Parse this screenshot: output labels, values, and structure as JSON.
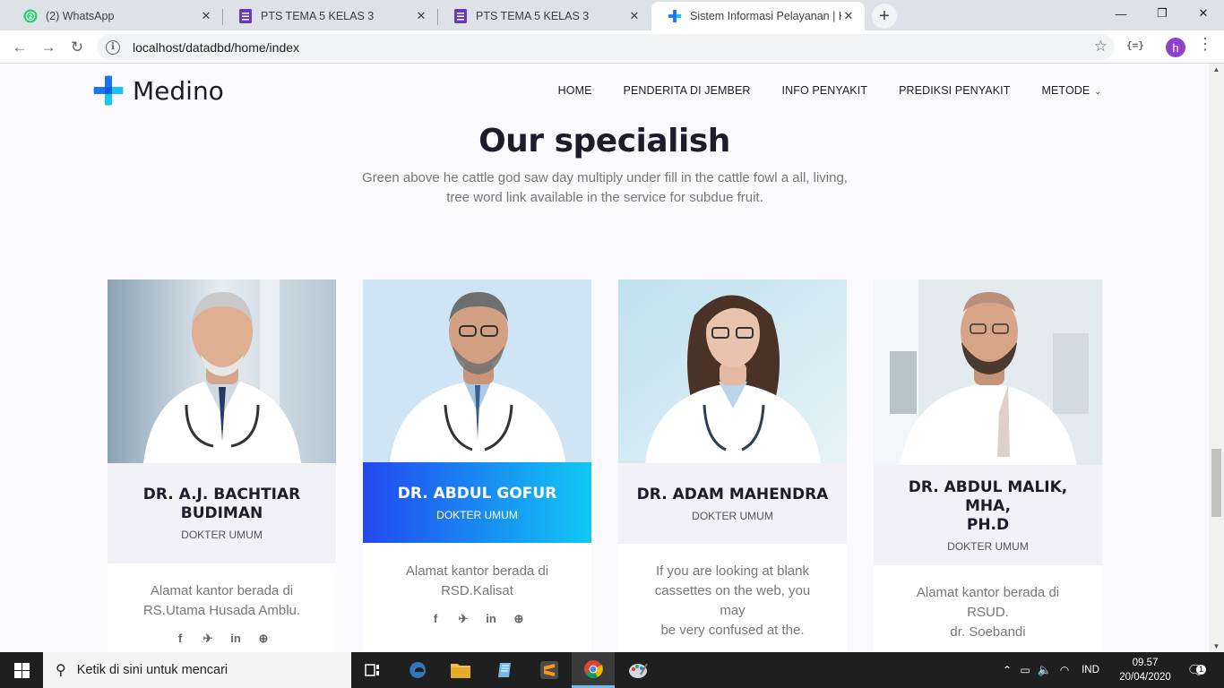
{
  "browser": {
    "tabs": [
      {
        "label": "(2) WhatsApp",
        "icon": "whatsapp-icon"
      },
      {
        "label": "PTS TEMA 5 KELAS 3",
        "icon": "forms-icon"
      },
      {
        "label": "PTS TEMA 5 KELAS 3",
        "icon": "forms-icon"
      },
      {
        "label": "Sistem Informasi Pelayanan | Kab",
        "icon": "medino-icon"
      }
    ],
    "url": "localhost/datadbd/home/index",
    "profile_initial": "h",
    "extension_label": "{=}"
  },
  "site": {
    "logo_text": "Medino",
    "menu": [
      "HOME",
      "PENDERITA DI JEMBER",
      "INFO PENYAKIT",
      "PREDIKSI PENYAKIT",
      "METODE"
    ]
  },
  "section": {
    "title": "Our specialish",
    "subtitle_line1": "Green above he cattle god saw day multiply under fill in the cattle fowl a all, living,",
    "subtitle_line2": "tree word link available in the service for subdue fruit."
  },
  "doctors": [
    {
      "name_l1": "DR. A.J. BACHTIAR",
      "name_l2": "BUDIMAN",
      "role": "DOKTER UMUM",
      "addr_l1": "Alamat kantor berada di",
      "addr_l2": "RS.Utama Husada Amblu.",
      "addr_l3": ""
    },
    {
      "name_l1": "DR. ABDUL GOFUR",
      "name_l2": "",
      "role": "DOKTER UMUM",
      "addr_l1": "Alamat kantor berada di",
      "addr_l2": "RSD.Kalisat",
      "addr_l3": ""
    },
    {
      "name_l1": "DR. ADAM MAHENDRA",
      "name_l2": "",
      "role": "DOKTER UMUM",
      "addr_l1": "If you are looking at blank",
      "addr_l2": "cassettes on the web, you may",
      "addr_l3": "be very confused at the."
    },
    {
      "name_l1": "DR. ABDUL MALIK, MHA,",
      "name_l2": "PH.D",
      "role": "DOKTER UMUM",
      "addr_l1": "Alamat kantor berada di RSUD.",
      "addr_l2": "dr. Soebandi",
      "addr_l3": ""
    }
  ],
  "social": {
    "facebook": "f",
    "twitter": "🐦",
    "linkedin": "in",
    "pinterest": "℗"
  },
  "taskbar": {
    "search_placeholder": "Ketik di sini untuk mencari",
    "language": "IND",
    "time": "09.57",
    "date": "20/04/2020",
    "notifications": "1"
  },
  "colors": {
    "accent_start": "#2348f0",
    "accent_end": "#11c8f4",
    "logo_blue": "#1976f0",
    "logo_cyan": "#16c6f2"
  }
}
